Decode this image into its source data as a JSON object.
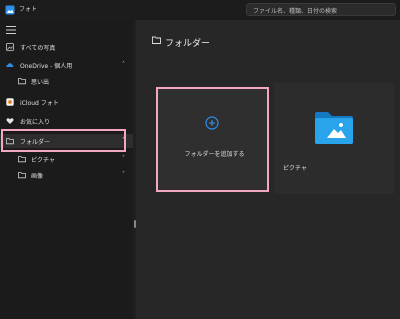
{
  "app": {
    "title": "フォト"
  },
  "search": {
    "placeholder": "ファイル名、種類、日付の検索"
  },
  "sidebar": {
    "items": [
      {
        "label": "すべての写真",
        "icon": "photos-icon"
      },
      {
        "label": "OneDrive - 個人用",
        "icon": "cloud-icon",
        "chevron": "˄"
      },
      {
        "label": "思い出",
        "icon": "folder-icon"
      },
      {
        "label": "iCloud フォト",
        "icon": "icloud-icon"
      },
      {
        "label": "お気に入り",
        "icon": "heart-icon"
      },
      {
        "label": "フォルダー",
        "icon": "folder-icon",
        "chevron": "˄",
        "selected": true
      },
      {
        "label": "ピクチャ",
        "icon": "folder-icon",
        "chevron": "˅"
      },
      {
        "label": "画像",
        "icon": "folder-icon",
        "chevron": "˅"
      }
    ]
  },
  "main": {
    "title": "フォルダー",
    "add_folder_label": "フォルダーを追加する",
    "folder_tile_label": "ピクチャ"
  },
  "colors": {
    "accent": "#2e8ee8",
    "highlight": "#f4a7c4",
    "folder_blue": "#1e90d8"
  }
}
